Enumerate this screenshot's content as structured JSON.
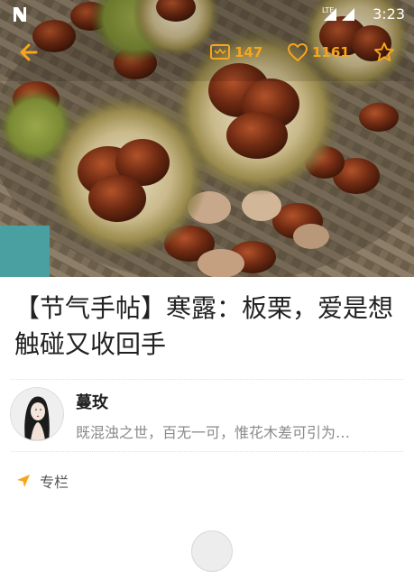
{
  "status_bar": {
    "network": "LTE",
    "time": "3:23"
  },
  "toolbar": {
    "back_icon": "arrow-left-icon",
    "comment_icon": "comment-icon",
    "comment_count": "147",
    "like_icon": "heart-icon",
    "like_count": "1161",
    "favorite_icon": "star-icon",
    "accent_color": "#f7a51c"
  },
  "article": {
    "hero_image": "chestnuts-in-basket",
    "title": "【节气手帖】寒露：板栗，爱是想触碰又收回手"
  },
  "author": {
    "name": "蔓玫",
    "bio": "既混浊之世，百无一可，惟花木差可引为…"
  },
  "category": {
    "icon": "navigation-arrow-icon",
    "label": "专栏"
  }
}
